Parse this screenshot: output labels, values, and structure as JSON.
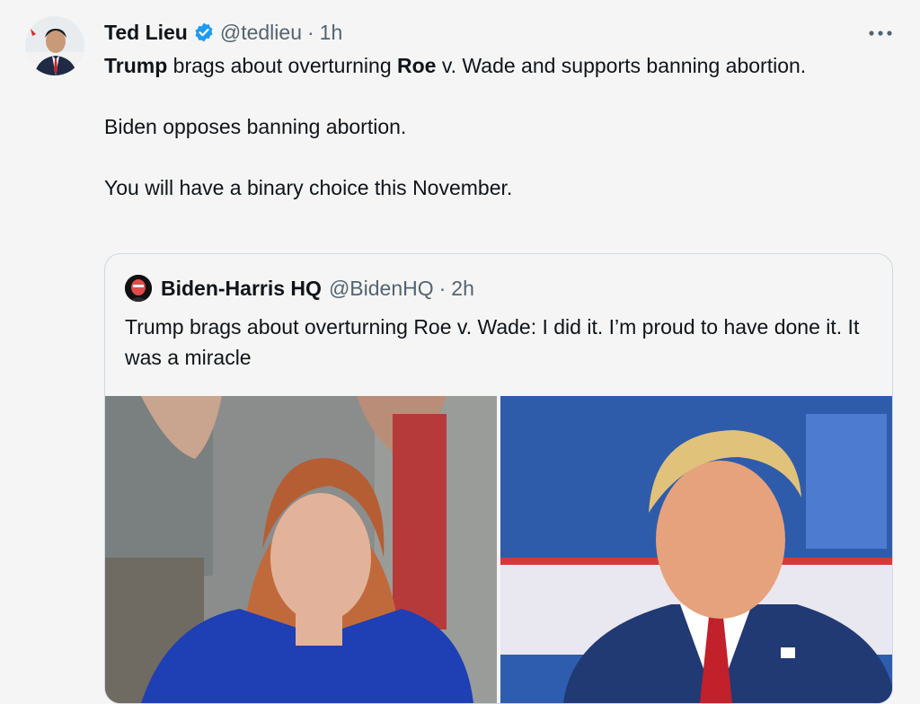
{
  "tweet": {
    "author": {
      "name": "Ted Lieu",
      "handle": "@tedlieu",
      "time": "1h",
      "verified": true
    },
    "separator": "·",
    "more_icon": "more-dots-icon",
    "line1": {
      "bold1": "Trump",
      "text1": " brags about overturning ",
      "bold2": "Roe",
      "text2": " v. Wade and supports banning abortion."
    },
    "line2": "Biden opposes banning abortion.",
    "line3": "You will have a binary choice this November."
  },
  "quote": {
    "author": {
      "name": "Biden-Harris HQ",
      "handle": "@BidenHQ",
      "time": "2h"
    },
    "text": "Trump brags about overturning Roe v. Wade: I did it. I’m proud to have done it. It was a miracle"
  },
  "colors": {
    "verified": "#1d9bf0",
    "muted": "#536471",
    "border": "#cfd9de"
  }
}
